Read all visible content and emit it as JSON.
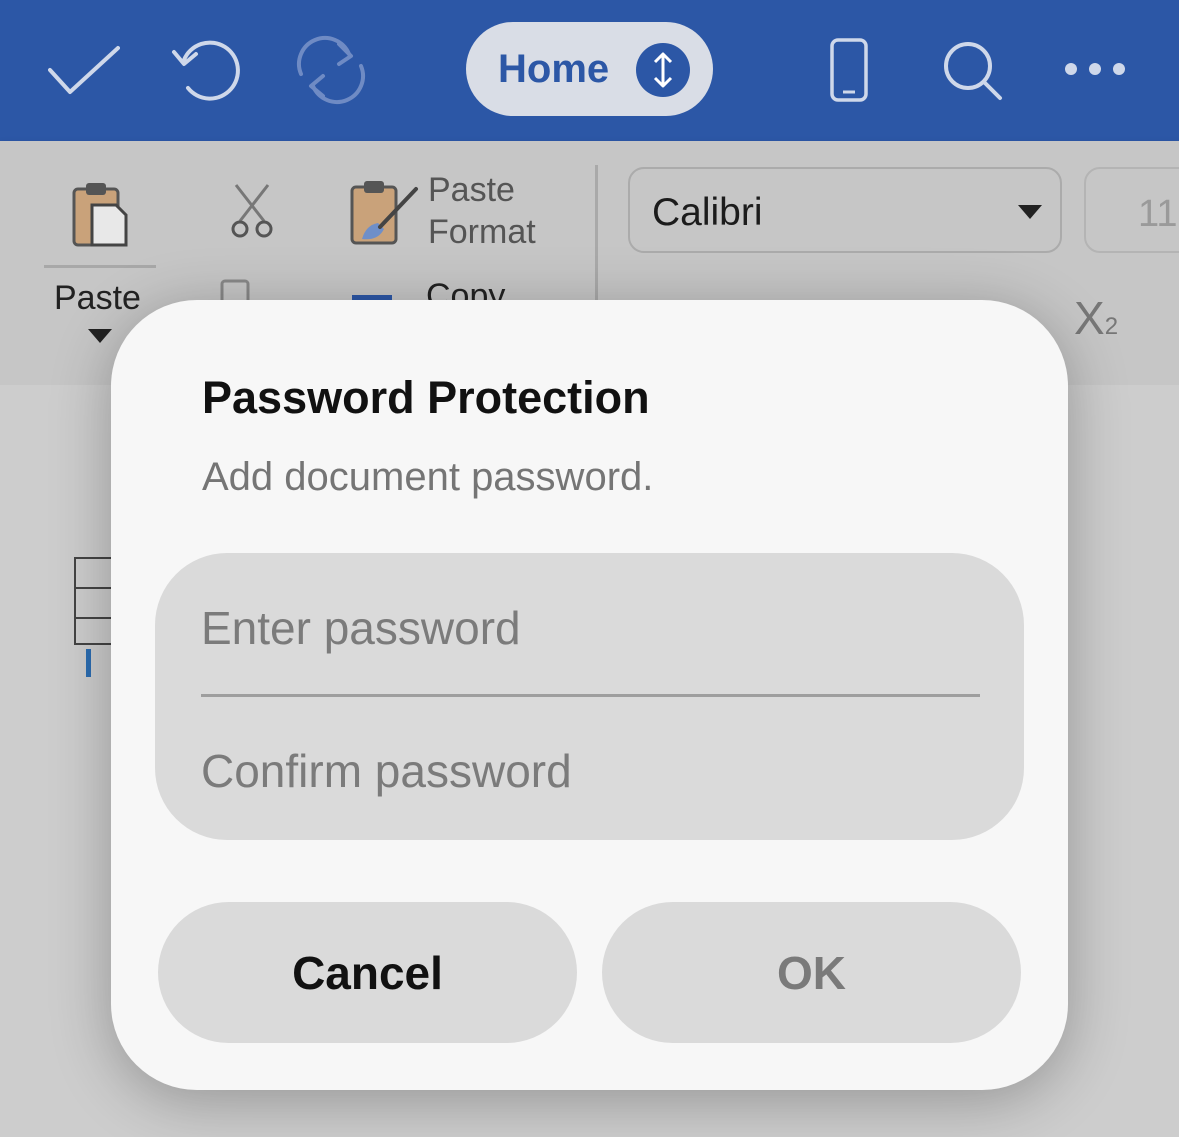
{
  "toolbar": {
    "home_label": "Home",
    "icons": [
      "checkmark-icon",
      "undo-icon",
      "redo-icon",
      "phone-view-icon",
      "search-icon",
      "more-icon"
    ]
  },
  "ribbon": {
    "paste_label": "Paste",
    "paste_format_line1": "Paste",
    "paste_format_line2": "Format",
    "copy_label": "Copy",
    "font_name": "Calibri",
    "font_size": "11",
    "subscript_label": "X",
    "subscript_digit": "2"
  },
  "dialog": {
    "title": "Password Protection",
    "subtitle": "Add document password.",
    "password_placeholder": "Enter password",
    "confirm_placeholder": "Confirm password",
    "cancel_label": "Cancel",
    "ok_label": "OK"
  },
  "colors": {
    "brand_blue": "#2c57a6",
    "dialog_bg": "#f7f7f7",
    "field_bg": "#dadada"
  }
}
